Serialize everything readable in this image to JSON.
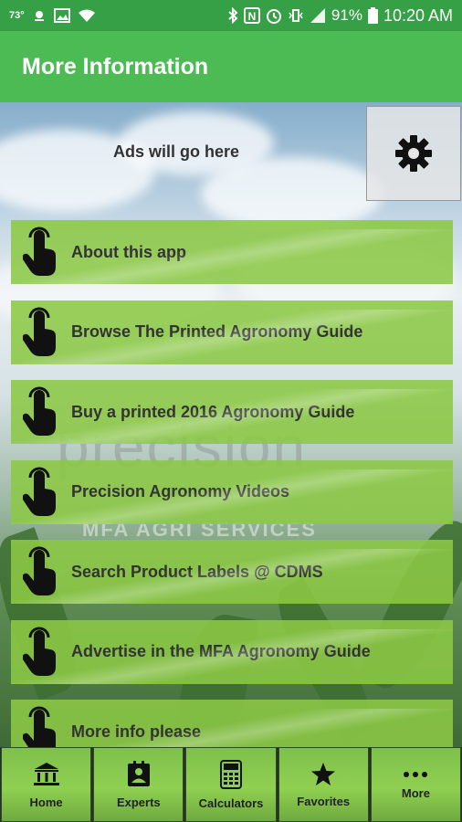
{
  "status_bar": {
    "temperature": "73°",
    "battery": "91%",
    "time": "10:20 AM"
  },
  "app_bar": {
    "title": "More Information"
  },
  "ad": {
    "text": "Ads will go here"
  },
  "background": {
    "watermark": "precision",
    "watermark_sub": "MFA AGRI SERVICES"
  },
  "menu": {
    "items": [
      {
        "label": "About this app"
      },
      {
        "label": "Browse The Printed Agronomy Guide"
      },
      {
        "label": "Buy a printed 2016 Agronomy Guide"
      },
      {
        "label": "Precision Agronomy Videos"
      },
      {
        "label": "Search Product Labels @ CDMS"
      },
      {
        "label": "Advertise in the MFA Agronomy Guide"
      },
      {
        "label": "More info please"
      }
    ]
  },
  "bottom_nav": {
    "items": [
      {
        "label": "Home",
        "icon": "bank-icon"
      },
      {
        "label": "Experts",
        "icon": "contact-icon"
      },
      {
        "label": "Calculators",
        "icon": "calculator-icon"
      },
      {
        "label": "Favorites",
        "icon": "star-icon"
      },
      {
        "label": "More",
        "icon": "more-dots-icon"
      }
    ]
  },
  "colors": {
    "status_bar": "#35a046",
    "app_bar": "#4cbb53",
    "menu_item": "#8cc846"
  }
}
